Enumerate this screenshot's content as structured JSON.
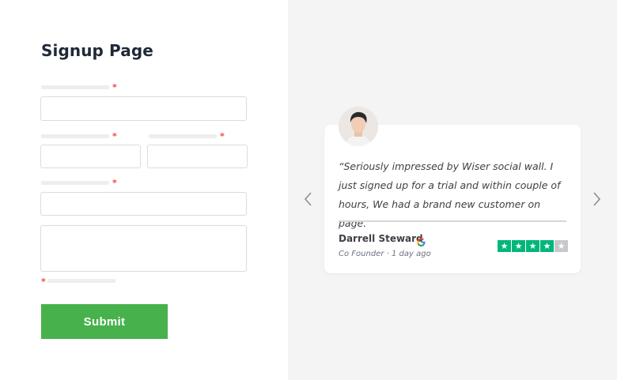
{
  "form": {
    "title": "Signup Page",
    "required_marker": "*",
    "submit_label": "Submit"
  },
  "testimonial": {
    "quote": "“Seriously impressed by Wiser social wall. I just signed up for a trial and within couple of hours, We had a brand new customer on page.",
    "author": "Darrell Steward",
    "role": "Co Founder",
    "separator": "·",
    "time": "1 day ago",
    "source_icon": "google-icon",
    "rating": 4,
    "rating_max": 5
  },
  "carousel": {
    "prev_icon": "chevron-left-icon",
    "next_icon": "chevron-right-icon"
  },
  "colors": {
    "accent": "#47b14b",
    "required": "#ef4444",
    "star_on": "#00b67a",
    "star_off": "#c8c8cc",
    "panel_bg": "#f4f4f5"
  }
}
